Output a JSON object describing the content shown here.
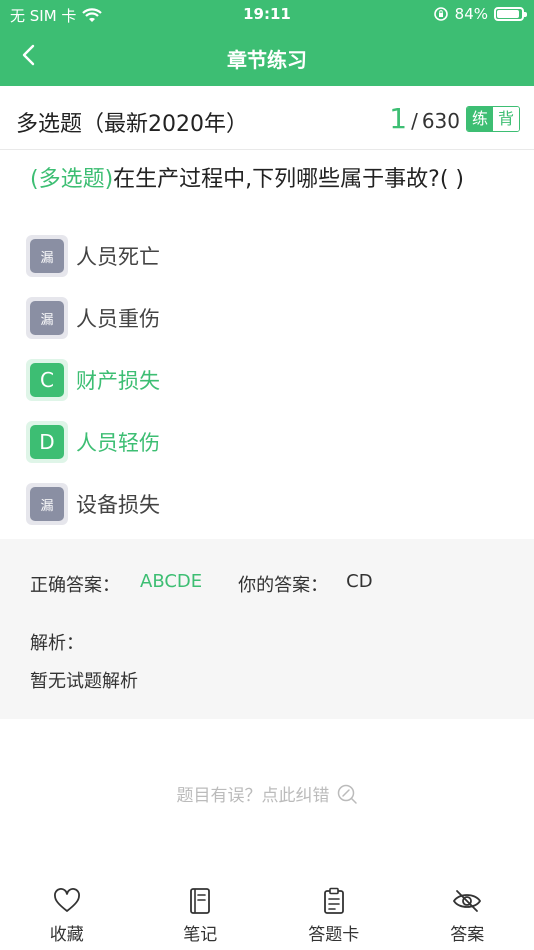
{
  "status": {
    "carrier": "无 SIM 卡",
    "time": "19:11",
    "battery": "84%"
  },
  "nav": {
    "title": "章节练习"
  },
  "subheader": {
    "section_title": "多选题（最新2020年）",
    "current": "1",
    "separator": "/",
    "total": "630",
    "mode_practice": "练",
    "mode_recite": "背"
  },
  "question": {
    "type": "(多选题)",
    "text": "在生产过程中,下列哪些属于事故?( )"
  },
  "options": [
    {
      "badge": "漏",
      "text": "人员死亡",
      "state": "missed"
    },
    {
      "badge": "漏",
      "text": "人员重伤",
      "state": "missed"
    },
    {
      "badge": "C",
      "text": "财产损失",
      "state": "correct"
    },
    {
      "badge": "D",
      "text": "人员轻伤",
      "state": "correct"
    },
    {
      "badge": "漏",
      "text": "设备损失",
      "state": "missed"
    }
  ],
  "answer": {
    "correct_label": "正确答案：",
    "correct_value": "ABCDE",
    "yours_label": "你的答案：",
    "yours_value": "CD",
    "analysis_label": "解析：",
    "analysis_text": "暂无试题解析"
  },
  "report": {
    "text": "题目有误？点此纠错",
    "icon": "search-edit-icon"
  },
  "toolbar": [
    {
      "label": "收藏",
      "icon": "heart-icon"
    },
    {
      "label": "笔记",
      "icon": "notebook-icon"
    },
    {
      "label": "答题卡",
      "icon": "clipboard-icon"
    },
    {
      "label": "答案",
      "icon": "eye-hidden-icon"
    }
  ],
  "colors": {
    "accent": "#3dbe73",
    "missed_badge": "#8a8fa3",
    "panel_bg": "#f6f6f6"
  }
}
